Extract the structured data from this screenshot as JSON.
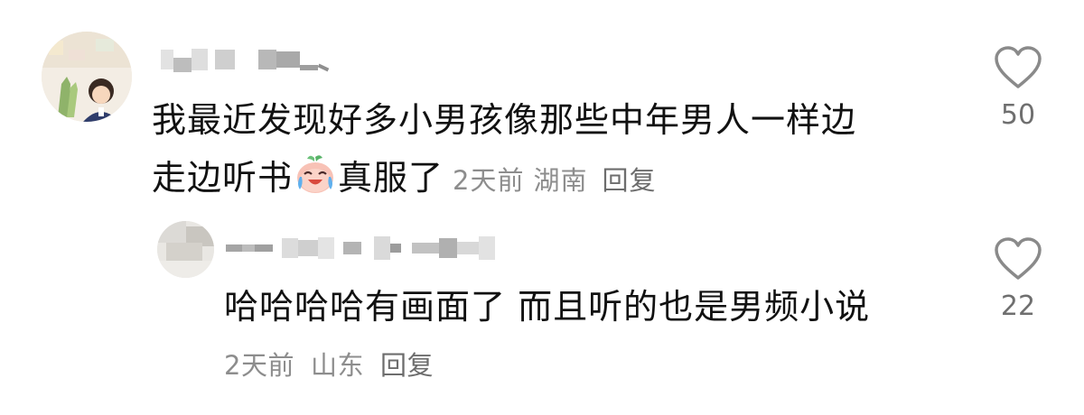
{
  "comments": [
    {
      "id": "main",
      "text_line1": "我最近发现好多小男孩像那些中年男人一样边",
      "text_line2_before": "走边听书",
      "emoji": "crying-laughing-peach-emoji",
      "text_line2_after": "真服了",
      "time": "2天前",
      "location": "湖南",
      "reply_label": "回复",
      "likes": "50",
      "like_icon": "heart-outline-icon"
    },
    {
      "id": "reply",
      "text": "哈哈哈哈有画面了 而且听的也是男频小说",
      "time": "2天前",
      "location": "山东",
      "reply_label": "回复",
      "likes": "22",
      "like_icon": "heart-outline-icon"
    }
  ],
  "colors": {
    "text": "#111111",
    "meta": "#8d8d8d",
    "icon": "#8a8a8a"
  }
}
